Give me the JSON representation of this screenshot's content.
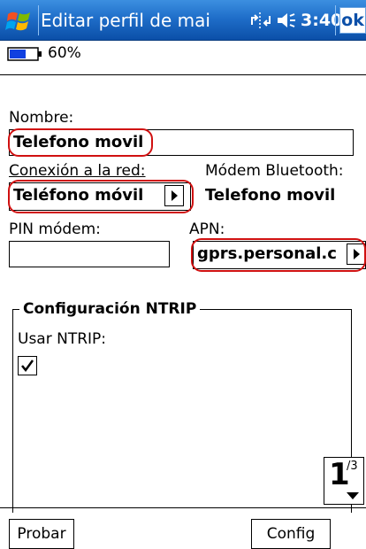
{
  "title_bar": {
    "title": "Editar perfil de mai",
    "clock": "3:40",
    "ok_label": "ok"
  },
  "status": {
    "battery_percent_text": "60%",
    "battery_level": 0.6
  },
  "form": {
    "nombre_label": "Nombre:",
    "nombre_value": "Telefono movil",
    "conexion_label": "Conexión a la red:",
    "conexion_value": "Teléfono móvil",
    "modem_bt_label": "Módem Bluetooth:",
    "modem_bt_value": "Telefono movil",
    "pin_label": "PIN módem:",
    "pin_value": "",
    "apn_label": "APN:",
    "apn_value": "gprs.personal.c"
  },
  "ntrip": {
    "group_title": "Configuración NTRIP",
    "usar_label": "Usar NTRIP:",
    "usar_checked": true
  },
  "pager": {
    "current": "1",
    "total": "/3"
  },
  "buttons": {
    "probar": "Probar",
    "config": "Config"
  },
  "colors": {
    "title_bar": "#1f6ec9",
    "highlight": "#d01010"
  },
  "icons": [
    "windows-logo-icon",
    "connectivity-icon",
    "volume-icon",
    "battery-icon",
    "dropdown-arrow-icon",
    "checkbox-check-icon",
    "chevron-down-icon"
  ]
}
